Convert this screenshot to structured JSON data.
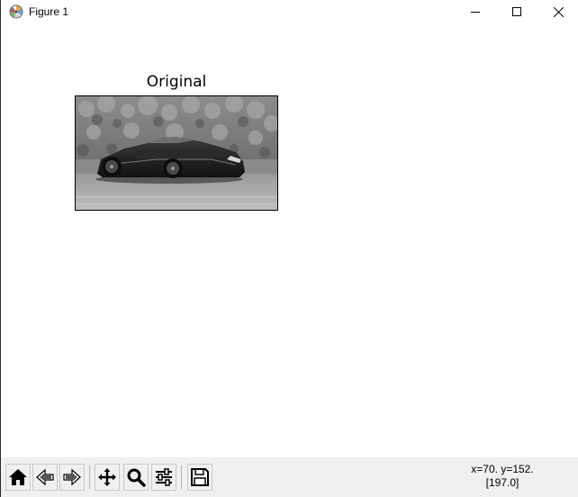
{
  "window": {
    "title": "Figure 1",
    "app_icon": "matplotlib-logo-icon",
    "controls": [
      "minimize-icon",
      "maximize-icon",
      "close-icon"
    ]
  },
  "figure": {
    "axes_title": "Original",
    "image": {
      "subject": "grayscale sports car on track",
      "colormap": "gray"
    }
  },
  "toolbar": {
    "buttons": [
      "home-icon",
      "back-icon",
      "forward-icon",
      "pan-icon",
      "zoom-icon",
      "configure-subplots-icon",
      "save-icon"
    ]
  },
  "status": {
    "coords_line1": "x=70. y=152.",
    "coords_line2": "[197.0]"
  }
}
